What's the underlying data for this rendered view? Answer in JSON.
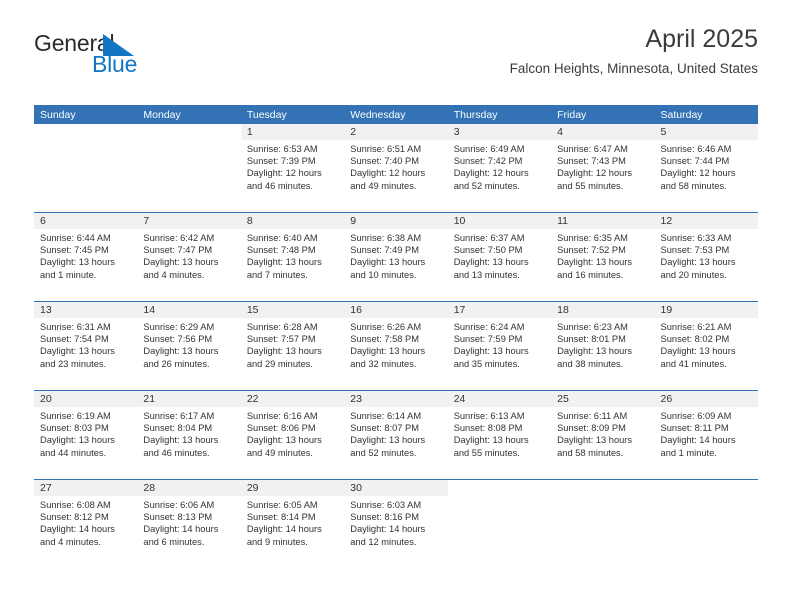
{
  "brand": {
    "name_part1": "General",
    "name_part2": "Blue",
    "triangle_color": "#1276c4",
    "text_color": "#2b2b2b"
  },
  "header": {
    "title": "April 2025",
    "subtitle": "Falcon Heights, Minnesota, United States"
  },
  "theme": {
    "accent": "#3272b5",
    "daynum_band": "#f1f1f1",
    "text": "#333333",
    "page_background": "#ffffff"
  },
  "calendar": {
    "weekday_headers": [
      "Sunday",
      "Monday",
      "Tuesday",
      "Wednesday",
      "Thursday",
      "Friday",
      "Saturday"
    ],
    "weeks": [
      {
        "days": [
          {
            "number": "",
            "sunrise": "",
            "sunset": "",
            "daylight_line1": "",
            "daylight_line2": ""
          },
          {
            "number": "",
            "sunrise": "",
            "sunset": "",
            "daylight_line1": "",
            "daylight_line2": ""
          },
          {
            "number": "1",
            "sunrise": "Sunrise: 6:53 AM",
            "sunset": "Sunset: 7:39 PM",
            "daylight_line1": "Daylight: 12 hours",
            "daylight_line2": "and 46 minutes."
          },
          {
            "number": "2",
            "sunrise": "Sunrise: 6:51 AM",
            "sunset": "Sunset: 7:40 PM",
            "daylight_line1": "Daylight: 12 hours",
            "daylight_line2": "and 49 minutes."
          },
          {
            "number": "3",
            "sunrise": "Sunrise: 6:49 AM",
            "sunset": "Sunset: 7:42 PM",
            "daylight_line1": "Daylight: 12 hours",
            "daylight_line2": "and 52 minutes."
          },
          {
            "number": "4",
            "sunrise": "Sunrise: 6:47 AM",
            "sunset": "Sunset: 7:43 PM",
            "daylight_line1": "Daylight: 12 hours",
            "daylight_line2": "and 55 minutes."
          },
          {
            "number": "5",
            "sunrise": "Sunrise: 6:46 AM",
            "sunset": "Sunset: 7:44 PM",
            "daylight_line1": "Daylight: 12 hours",
            "daylight_line2": "and 58 minutes."
          }
        ]
      },
      {
        "days": [
          {
            "number": "6",
            "sunrise": "Sunrise: 6:44 AM",
            "sunset": "Sunset: 7:45 PM",
            "daylight_line1": "Daylight: 13 hours",
            "daylight_line2": "and 1 minute."
          },
          {
            "number": "7",
            "sunrise": "Sunrise: 6:42 AM",
            "sunset": "Sunset: 7:47 PM",
            "daylight_line1": "Daylight: 13 hours",
            "daylight_line2": "and 4 minutes."
          },
          {
            "number": "8",
            "sunrise": "Sunrise: 6:40 AM",
            "sunset": "Sunset: 7:48 PM",
            "daylight_line1": "Daylight: 13 hours",
            "daylight_line2": "and 7 minutes."
          },
          {
            "number": "9",
            "sunrise": "Sunrise: 6:38 AM",
            "sunset": "Sunset: 7:49 PM",
            "daylight_line1": "Daylight: 13 hours",
            "daylight_line2": "and 10 minutes."
          },
          {
            "number": "10",
            "sunrise": "Sunrise: 6:37 AM",
            "sunset": "Sunset: 7:50 PM",
            "daylight_line1": "Daylight: 13 hours",
            "daylight_line2": "and 13 minutes."
          },
          {
            "number": "11",
            "sunrise": "Sunrise: 6:35 AM",
            "sunset": "Sunset: 7:52 PM",
            "daylight_line1": "Daylight: 13 hours",
            "daylight_line2": "and 16 minutes."
          },
          {
            "number": "12",
            "sunrise": "Sunrise: 6:33 AM",
            "sunset": "Sunset: 7:53 PM",
            "daylight_line1": "Daylight: 13 hours",
            "daylight_line2": "and 20 minutes."
          }
        ]
      },
      {
        "days": [
          {
            "number": "13",
            "sunrise": "Sunrise: 6:31 AM",
            "sunset": "Sunset: 7:54 PM",
            "daylight_line1": "Daylight: 13 hours",
            "daylight_line2": "and 23 minutes."
          },
          {
            "number": "14",
            "sunrise": "Sunrise: 6:29 AM",
            "sunset": "Sunset: 7:56 PM",
            "daylight_line1": "Daylight: 13 hours",
            "daylight_line2": "and 26 minutes."
          },
          {
            "number": "15",
            "sunrise": "Sunrise: 6:28 AM",
            "sunset": "Sunset: 7:57 PM",
            "daylight_line1": "Daylight: 13 hours",
            "daylight_line2": "and 29 minutes."
          },
          {
            "number": "16",
            "sunrise": "Sunrise: 6:26 AM",
            "sunset": "Sunset: 7:58 PM",
            "daylight_line1": "Daylight: 13 hours",
            "daylight_line2": "and 32 minutes."
          },
          {
            "number": "17",
            "sunrise": "Sunrise: 6:24 AM",
            "sunset": "Sunset: 7:59 PM",
            "daylight_line1": "Daylight: 13 hours",
            "daylight_line2": "and 35 minutes."
          },
          {
            "number": "18",
            "sunrise": "Sunrise: 6:23 AM",
            "sunset": "Sunset: 8:01 PM",
            "daylight_line1": "Daylight: 13 hours",
            "daylight_line2": "and 38 minutes."
          },
          {
            "number": "19",
            "sunrise": "Sunrise: 6:21 AM",
            "sunset": "Sunset: 8:02 PM",
            "daylight_line1": "Daylight: 13 hours",
            "daylight_line2": "and 41 minutes."
          }
        ]
      },
      {
        "days": [
          {
            "number": "20",
            "sunrise": "Sunrise: 6:19 AM",
            "sunset": "Sunset: 8:03 PM",
            "daylight_line1": "Daylight: 13 hours",
            "daylight_line2": "and 44 minutes."
          },
          {
            "number": "21",
            "sunrise": "Sunrise: 6:17 AM",
            "sunset": "Sunset: 8:04 PM",
            "daylight_line1": "Daylight: 13 hours",
            "daylight_line2": "and 46 minutes."
          },
          {
            "number": "22",
            "sunrise": "Sunrise: 6:16 AM",
            "sunset": "Sunset: 8:06 PM",
            "daylight_line1": "Daylight: 13 hours",
            "daylight_line2": "and 49 minutes."
          },
          {
            "number": "23",
            "sunrise": "Sunrise: 6:14 AM",
            "sunset": "Sunset: 8:07 PM",
            "daylight_line1": "Daylight: 13 hours",
            "daylight_line2": "and 52 minutes."
          },
          {
            "number": "24",
            "sunrise": "Sunrise: 6:13 AM",
            "sunset": "Sunset: 8:08 PM",
            "daylight_line1": "Daylight: 13 hours",
            "daylight_line2": "and 55 minutes."
          },
          {
            "number": "25",
            "sunrise": "Sunrise: 6:11 AM",
            "sunset": "Sunset: 8:09 PM",
            "daylight_line1": "Daylight: 13 hours",
            "daylight_line2": "and 58 minutes."
          },
          {
            "number": "26",
            "sunrise": "Sunrise: 6:09 AM",
            "sunset": "Sunset: 8:11 PM",
            "daylight_line1": "Daylight: 14 hours",
            "daylight_line2": "and 1 minute."
          }
        ]
      },
      {
        "days": [
          {
            "number": "27",
            "sunrise": "Sunrise: 6:08 AM",
            "sunset": "Sunset: 8:12 PM",
            "daylight_line1": "Daylight: 14 hours",
            "daylight_line2": "and 4 minutes."
          },
          {
            "number": "28",
            "sunrise": "Sunrise: 6:06 AM",
            "sunset": "Sunset: 8:13 PM",
            "daylight_line1": "Daylight: 14 hours",
            "daylight_line2": "and 6 minutes."
          },
          {
            "number": "29",
            "sunrise": "Sunrise: 6:05 AM",
            "sunset": "Sunset: 8:14 PM",
            "daylight_line1": "Daylight: 14 hours",
            "daylight_line2": "and 9 minutes."
          },
          {
            "number": "30",
            "sunrise": "Sunrise: 6:03 AM",
            "sunset": "Sunset: 8:16 PM",
            "daylight_line1": "Daylight: 14 hours",
            "daylight_line2": "and 12 minutes."
          },
          {
            "number": "",
            "sunrise": "",
            "sunset": "",
            "daylight_line1": "",
            "daylight_line2": ""
          },
          {
            "number": "",
            "sunrise": "",
            "sunset": "",
            "daylight_line1": "",
            "daylight_line2": ""
          },
          {
            "number": "",
            "sunrise": "",
            "sunset": "",
            "daylight_line1": "",
            "daylight_line2": ""
          }
        ]
      }
    ]
  }
}
